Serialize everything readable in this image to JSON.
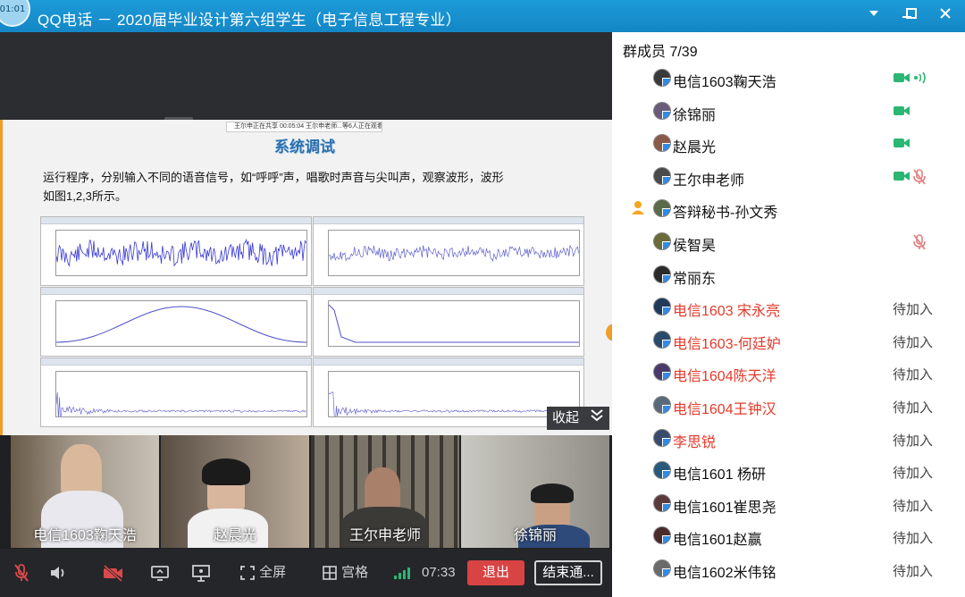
{
  "window": {
    "timer_badge": "01:01",
    "title": "QQ电话 － 2020届毕业设计第六组学生（电子信息工程专业）",
    "icons": [
      "chevron-down-icon",
      "minimize-icon",
      "maximize-icon",
      "close-icon"
    ]
  },
  "share": {
    "banner": "王尔申正在共享    00:05:04    王尔申老师...等6人正在观看",
    "slide_title": "系统调试",
    "slide_body": "运行程序，分别输入不同的语音信号，如“呼呼”声，唱歌时声音与尖叫声，观察波形，波形如图1,2,3所示。",
    "collapse_label": "收起"
  },
  "videos": [
    {
      "name": "电信1603鞠天浩",
      "bg": "#8f8478"
    },
    {
      "name": "赵晨光",
      "bg": "#6e6560"
    },
    {
      "name": "王尔申老师",
      "bg": "#5c574f"
    },
    {
      "name": "徐锦丽",
      "bg": "#8e8c86"
    }
  ],
  "toolbar": {
    "mute_icon": "mic-off-icon",
    "speaker_icon": "speaker-icon",
    "camera_icon": "camera-off-icon",
    "share_icon": "screen-share-icon",
    "present_icon": "presenter-icon",
    "fullscreen_label": "全屏",
    "grid_label": "宫格",
    "elapsed": "07:33",
    "exit_label": "退出",
    "end_label": "结束通..."
  },
  "members": {
    "header": "群成员 7/39",
    "list": [
      {
        "name": "电信1603鞠天浩",
        "status": "",
        "red": false,
        "video": true,
        "speaking": true,
        "mic_off": false,
        "host": false
      },
      {
        "name": "徐锦丽",
        "status": "",
        "red": false,
        "video": true,
        "speaking": false,
        "mic_off": false,
        "host": false
      },
      {
        "name": "赵晨光",
        "status": "",
        "red": false,
        "video": true,
        "speaking": false,
        "mic_off": false,
        "host": false
      },
      {
        "name": "王尔申老师",
        "status": "",
        "red": false,
        "video": true,
        "speaking": false,
        "mic_off": true,
        "host": false
      },
      {
        "name": "答辩秘书-孙文秀",
        "status": "",
        "red": false,
        "video": false,
        "speaking": false,
        "mic_off": false,
        "host": true
      },
      {
        "name": "侯智昊",
        "status": "",
        "red": false,
        "video": false,
        "speaking": false,
        "mic_off": true,
        "host": false
      },
      {
        "name": "常丽东",
        "status": "",
        "red": false,
        "video": false,
        "speaking": false,
        "mic_off": false,
        "host": false
      },
      {
        "name": "电信1603 宋永亮",
        "status": "待加入",
        "red": true,
        "video": false,
        "speaking": false,
        "mic_off": false,
        "host": false
      },
      {
        "name": "电信1603-何廷妒",
        "status": "待加入",
        "red": true,
        "video": false,
        "speaking": false,
        "mic_off": false,
        "host": false
      },
      {
        "name": "电信1604陈天洋",
        "status": "待加入",
        "red": true,
        "video": false,
        "speaking": false,
        "mic_off": false,
        "host": false
      },
      {
        "name": "电信1604王钟汉",
        "status": "待加入",
        "red": true,
        "video": false,
        "speaking": false,
        "mic_off": false,
        "host": false
      },
      {
        "name": "李思锐",
        "status": "待加入",
        "red": true,
        "video": false,
        "speaking": false,
        "mic_off": false,
        "host": false
      },
      {
        "name": "电信1601  杨研",
        "status": "待加入",
        "red": false,
        "video": false,
        "speaking": false,
        "mic_off": false,
        "host": false
      },
      {
        "name": "电信1601崔思尧",
        "status": "待加入",
        "red": false,
        "video": false,
        "speaking": false,
        "mic_off": false,
        "host": false
      },
      {
        "name": "电信1601赵赢",
        "status": "待加入",
        "red": false,
        "video": false,
        "speaking": false,
        "mic_off": false,
        "host": false
      },
      {
        "name": "电信1602米伟铭",
        "status": "待加入",
        "red": false,
        "video": false,
        "speaking": false,
        "mic_off": false,
        "host": false
      }
    ]
  },
  "colors": {
    "accent": "#1487c6",
    "exit": "#d84343",
    "video_green": "#2bb673",
    "waiting_red": "#e33a2a",
    "slide_border": "#f19d2a"
  }
}
